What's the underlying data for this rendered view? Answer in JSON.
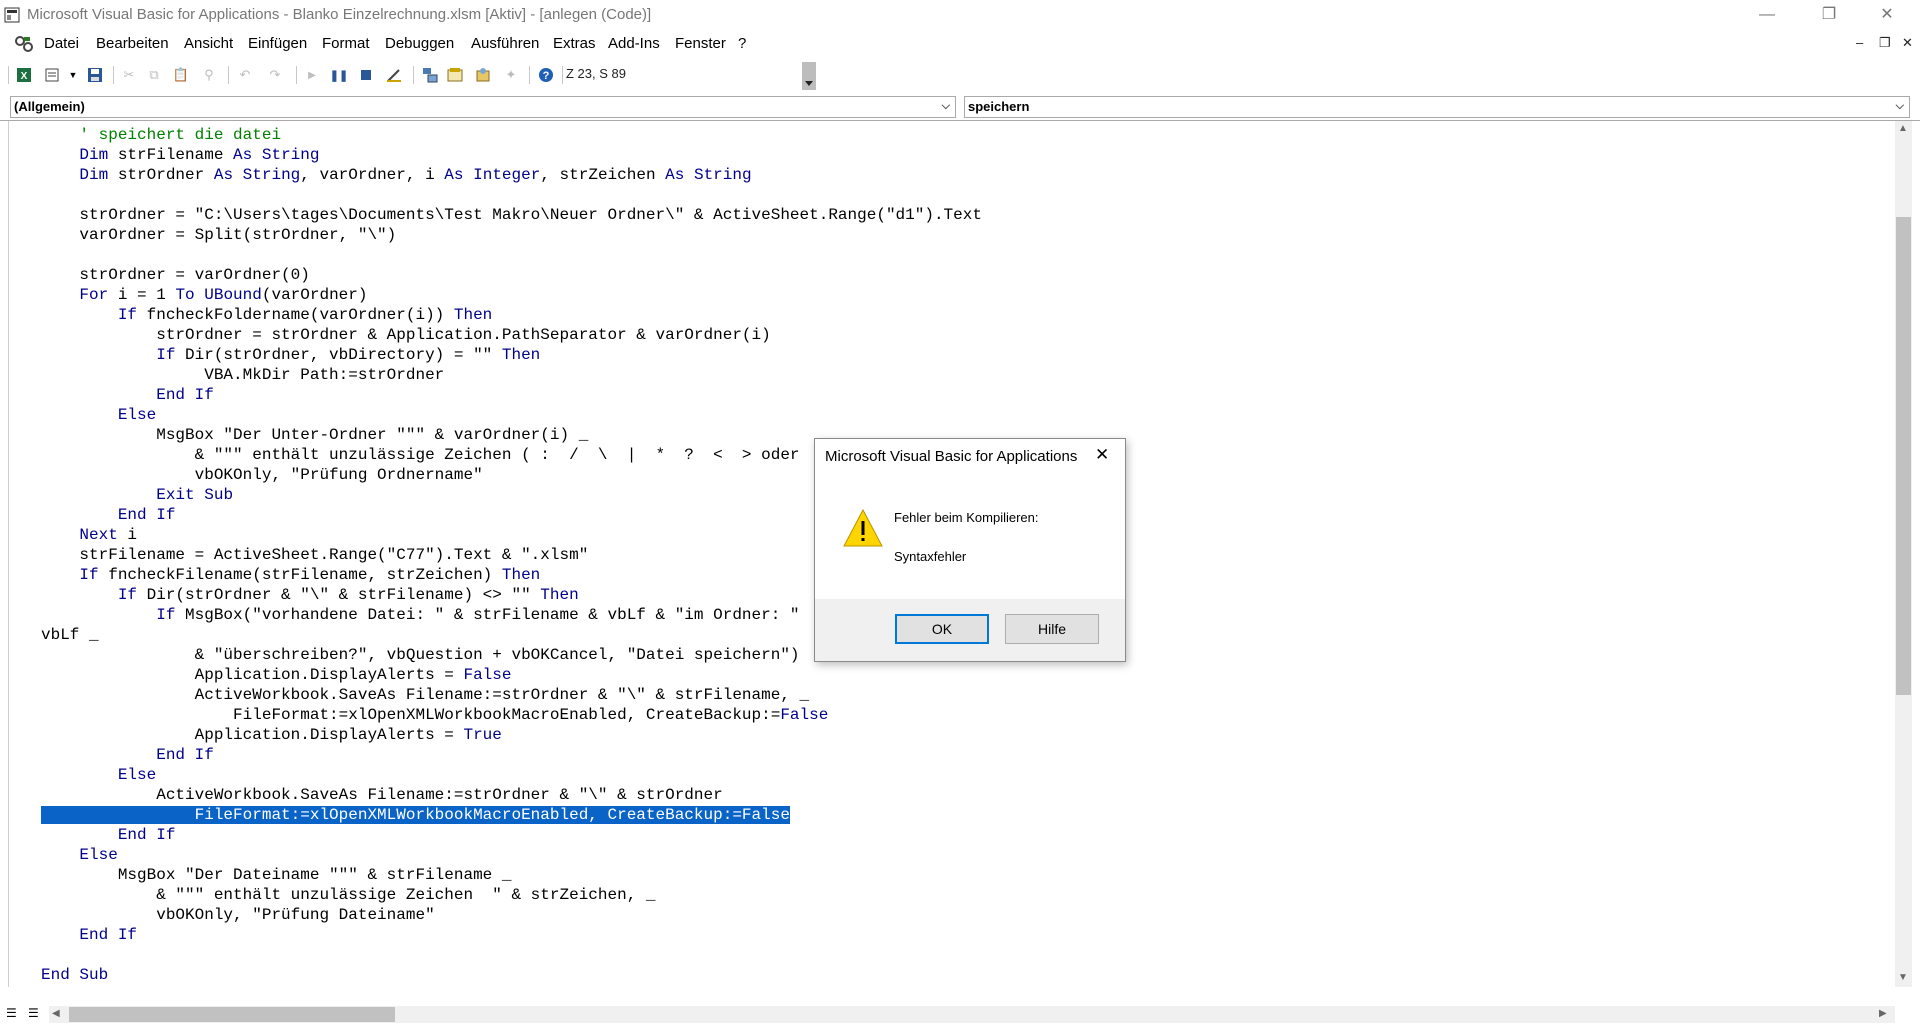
{
  "window": {
    "title": "Microsoft Visual Basic for Applications - Blanko Einzelrechnung.xlsm [Aktiv] - [anlegen (Code)]",
    "controls": [
      "minimize-icon",
      "restore-icon",
      "close-icon"
    ]
  },
  "menu": {
    "items": [
      "Datei",
      "Bearbeiten",
      "Ansicht",
      "Einfügen",
      "Format",
      "Debuggen",
      "Ausführen",
      "Extras",
      "Add-Ins",
      "Fenster",
      "?"
    ]
  },
  "toolbar": {
    "position_text": "Z 23, S 89",
    "buttons": [
      "excel-view-icon",
      "insert-module-icon",
      "save-icon",
      "cut-icon",
      "copy-icon",
      "paste-icon",
      "find-icon",
      "undo-icon",
      "redo-icon",
      "run-icon",
      "break-icon",
      "reset-icon",
      "design-mode-icon",
      "project-explorer-icon",
      "properties-icon",
      "object-browser-icon",
      "toolbox-icon",
      "help-icon"
    ]
  },
  "object_combo": {
    "value": "(Allgemein)"
  },
  "procedure_combo": {
    "value": "speichern"
  },
  "code": {
    "lines": [
      "    ' speichert die datei",
      "    Dim strFilename As String",
      "    Dim strOrdner As String, varOrdner, i As Integer, strZeichen As String",
      "",
      "    strOrdner = \"C:\\Users\\tages\\Documents\\Test Makro\\Neuer Ordner\\\" & ActiveSheet.Range(\"d1\").Text",
      "    varOrdner = Split(strOrdner, \"\\\")",
      "",
      "    strOrdner = varOrdner(0)",
      "    For i = 1 To UBound(varOrdner)",
      "        If fncheckFoldername(varOrdner(i)) Then",
      "            strOrdner = strOrdner & Application.PathSeparator & varOrdner(i)",
      "            If Dir(strOrdner, vbDirectory) = \"\" Then",
      "                 VBA.MkDir Path:=strOrdner",
      "            End If",
      "        Else",
      "            MsgBox \"Der Unter-Ordner \"\"\" & varOrdner(i) _",
      "                & \"\"\" enthält unzulässige Zeichen ( :  /  \\  |  *  ?  <  > oder",
      "                vbOKOnly, \"Prüfung Ordnername\"",
      "            Exit Sub",
      "        End If",
      "    Next i",
      "    strFilename = ActiveSheet.Range(\"C77\").Text & \".xlsm\"",
      "    If fncheckFilename(strFilename, strZeichen) Then",
      "        If Dir(strOrdner & \"\\\" & strFilename) <> \"\" Then",
      "            If MsgBox(\"vorhandene Datei: \" & strFilename & vbLf & \"im Ordner: \"",
      "vbLf _",
      "                & \"überschreiben?\", vbQuestion + vbOKCancel, \"Datei speichern\")",
      "                Application.DisplayAlerts = False",
      "                ActiveWorkbook.SaveAs Filename:=strOrdner & \"\\\" & strFilename, _",
      "                    FileFormat:=xlOpenXMLWorkbookMacroEnabled, CreateBackup:=False",
      "                Application.DisplayAlerts = True",
      "            End If",
      "        Else",
      "            ActiveWorkbook.SaveAs Filename:=strOrdner & \"\\\" & strOrdner",
      "                FileFormat:=xlOpenXMLWorkbookMacroEnabled, CreateBackup:=False",
      "        End If",
      "    Else",
      "        MsgBox \"Der Dateiname \"\"\" & strFilename _",
      "            & \"\"\" enthält unzulässige Zeichen  \" & strZeichen, _",
      "            vbOKOnly, \"Prüfung Dateiname\"",
      "    End If",
      "",
      "End Sub"
    ],
    "selected_line_index": 34,
    "keyword_color": "#00008b",
    "comment_color": "#008000",
    "selection_color": "#0a64c8"
  },
  "dialog": {
    "title": "Microsoft Visual Basic for Applications",
    "icon": "warning-icon",
    "heading": "Fehler beim Kompilieren:",
    "message": "Syntaxfehler",
    "ok_label": "OK",
    "help_label": "Hilfe"
  }
}
